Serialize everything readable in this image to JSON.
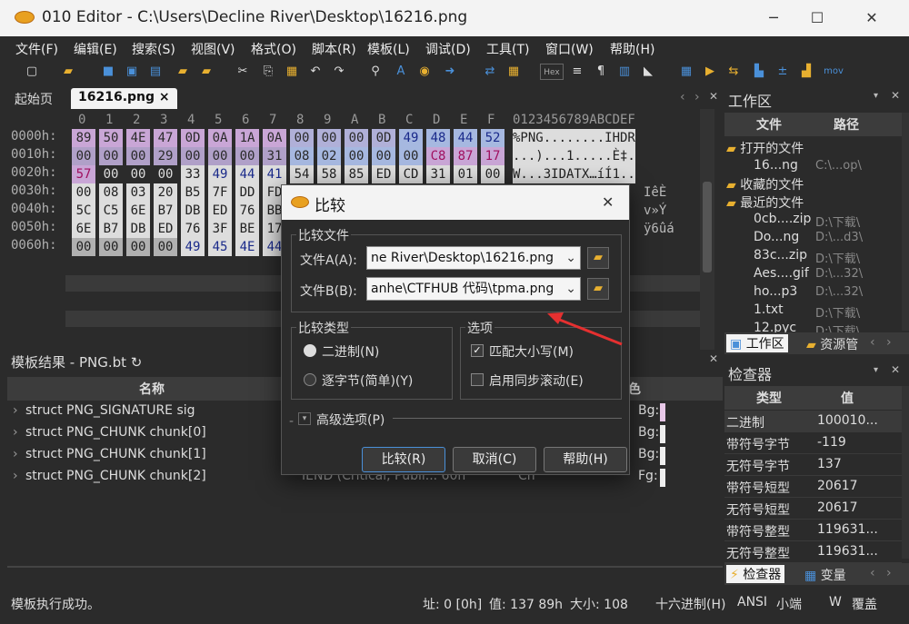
{
  "window": {
    "title": "010 Editor - C:\\Users\\Decline River\\Desktop\\16216.png",
    "minimize": "─",
    "maximize": "☐",
    "close": "✕"
  },
  "menu": [
    "文件(F)",
    "编辑(E)",
    "搜索(S)",
    "视图(V)",
    "格式(O)",
    "脚本(R)",
    "模板(L)",
    "调试(D)",
    "工具(T)",
    "窗口(W)",
    "帮助(H)"
  ],
  "toolbar": {
    "hex_label": "Hex",
    "mov_label": "mov"
  },
  "tabs": {
    "start": "起始页",
    "file": "16216.png",
    "close": "×"
  },
  "hex": {
    "col_headers": [
      "0",
      "1",
      "2",
      "3",
      "4",
      "5",
      "6",
      "7",
      "8",
      "9",
      "A",
      "B",
      "C",
      "D",
      "E",
      "F"
    ],
    "ascii_header": "0123456789ABCDEF",
    "rows": [
      {
        "addr": "0000h:",
        "bytes": [
          "89",
          "50",
          "4E",
          "47",
          "0D",
          "0A",
          "1A",
          "0A",
          "00",
          "00",
          "00",
          "0D",
          "49",
          "48",
          "44",
          "52"
        ],
        "ascii": "%PNG........IHDR"
      },
      {
        "addr": "0010h:",
        "bytes": [
          "00",
          "00",
          "00",
          "29",
          "00",
          "00",
          "00",
          "31",
          "08",
          "02",
          "00",
          "00",
          "00",
          "C8",
          "87",
          "17"
        ],
        "ascii": "...)...1.....È‡."
      },
      {
        "addr": "0020h:",
        "bytes": [
          "57",
          "00",
          "00",
          "00",
          "33",
          "49",
          "44",
          "41",
          "54",
          "58",
          "85",
          "ED",
          "CD",
          "31",
          "01",
          "00"
        ],
        "ascii": "W...3IDATX…íÍ1.."
      },
      {
        "addr": "0030h:",
        "bytes": [
          "00",
          "08",
          "03",
          "20",
          "B5",
          "7F",
          "DD",
          "FD",
          "",
          "",
          "",
          "",
          "",
          "",
          "",
          ""
        ],
        "ascii": "IêÈ"
      },
      {
        "addr": "0040h:",
        "bytes": [
          "5C",
          "C5",
          "6E",
          "B7",
          "DB",
          "ED",
          "76",
          "BB",
          "",
          "",
          "",
          "",
          "",
          "",
          "",
          ""
        ],
        "ascii": "v»Ý"
      },
      {
        "addr": "0050h:",
        "bytes": [
          "6E",
          "B7",
          "DB",
          "ED",
          "76",
          "3F",
          "BE",
          "17",
          "",
          "",
          "",
          "",
          "",
          "",
          "",
          ""
        ],
        "ascii": "ÿ6ûá"
      },
      {
        "addr": "0060h:",
        "bytes": [
          "00",
          "00",
          "00",
          "00",
          "49",
          "45",
          "4E",
          "44",
          "",
          "",
          "",
          "",
          "",
          "",
          "",
          ""
        ],
        "ascii": ""
      }
    ]
  },
  "template": {
    "title": "模板结果 - PNG.bt",
    "refresh_icon": "↻",
    "columns": [
      "名称",
      "色"
    ],
    "rows": [
      {
        "name": "struct PNG_SIGNATURE sig",
        "color": "Bg:"
      },
      {
        "name": "struct PNG_CHUNK chunk[0]",
        "color": "Bg:"
      },
      {
        "name": "struct PNG_CHUNK chunk[1]",
        "color": "Bg:"
      },
      {
        "name": "struct PNG_CHUNK chunk[2]",
        "value": "IEND  (Critical, Publi... 60h",
        "extra": "Ch",
        "color": "Fg:"
      }
    ]
  },
  "workspace": {
    "title": "工作区",
    "columns": [
      "文件",
      "路径"
    ],
    "open_files": "打开的文件",
    "open_items": [
      {
        "name": "16...ng",
        "path": "C:\\...op\\"
      }
    ],
    "favorites": "收藏的文件",
    "recent": "最近的文件",
    "recent_items": [
      {
        "name": "0cb....zip",
        "path": "D:\\下载\\"
      },
      {
        "name": "Do...ng",
        "path": "D:\\...d3\\"
      },
      {
        "name": "83c...zip",
        "path": "D:\\下载\\"
      },
      {
        "name": "Aes....gif",
        "path": "D:\\...32\\"
      },
      {
        "name": "ho...p3",
        "path": "D:\\...32\\"
      },
      {
        "name": "1.txt",
        "path": "D:\\下载\\"
      },
      {
        "name": "12.pyc",
        "path": "D:\\下载\\"
      }
    ],
    "tab_workspace": "工作区",
    "tab_resources": "资源管"
  },
  "inspector": {
    "title": "检查器",
    "columns": [
      "类型",
      "值"
    ],
    "rows": [
      {
        "type": "二进制",
        "value": "100010..."
      },
      {
        "type": "带符号字节",
        "value": "-119"
      },
      {
        "type": "无符号字节",
        "value": "137"
      },
      {
        "type": "带符号短型",
        "value": "20617"
      },
      {
        "type": "无符号短型",
        "value": "20617"
      },
      {
        "type": "带符号整型",
        "value": "119631..."
      },
      {
        "type": "无符号整型",
        "value": "119631..."
      }
    ],
    "tab_inspector": "检查器",
    "tab_vars": "变量"
  },
  "status": {
    "message": "模板执行成功。",
    "address": "址: 0 [0h]",
    "value": "值: 137 89h",
    "size": "大小: 108",
    "mode": "十六进制(H)",
    "charset": "ANSI",
    "endian": "小端",
    "w": "W",
    "overwrite": "覆盖"
  },
  "dialog": {
    "title": "比较",
    "close": "✕",
    "files_group": "比较文件",
    "file_a_label": "文件A(A):",
    "file_a_value": "ne River\\Desktop\\16216.png",
    "file_b_label": "文件B(B):",
    "file_b_value": "anhe\\CTFHUB 代码\\tpma.png",
    "type_group": "比较类型",
    "binary": "二进制(N)",
    "bytewise": "逐字节(简单)(Y)",
    "options_group": "选项",
    "match_case": "匹配大小写(M)",
    "sync_scroll": "启用同步滚动(E)",
    "advanced": "高级选项(P)",
    "compare_btn": "比较(R)",
    "cancel_btn": "取消(C)",
    "help_btn": "帮助(H)"
  }
}
